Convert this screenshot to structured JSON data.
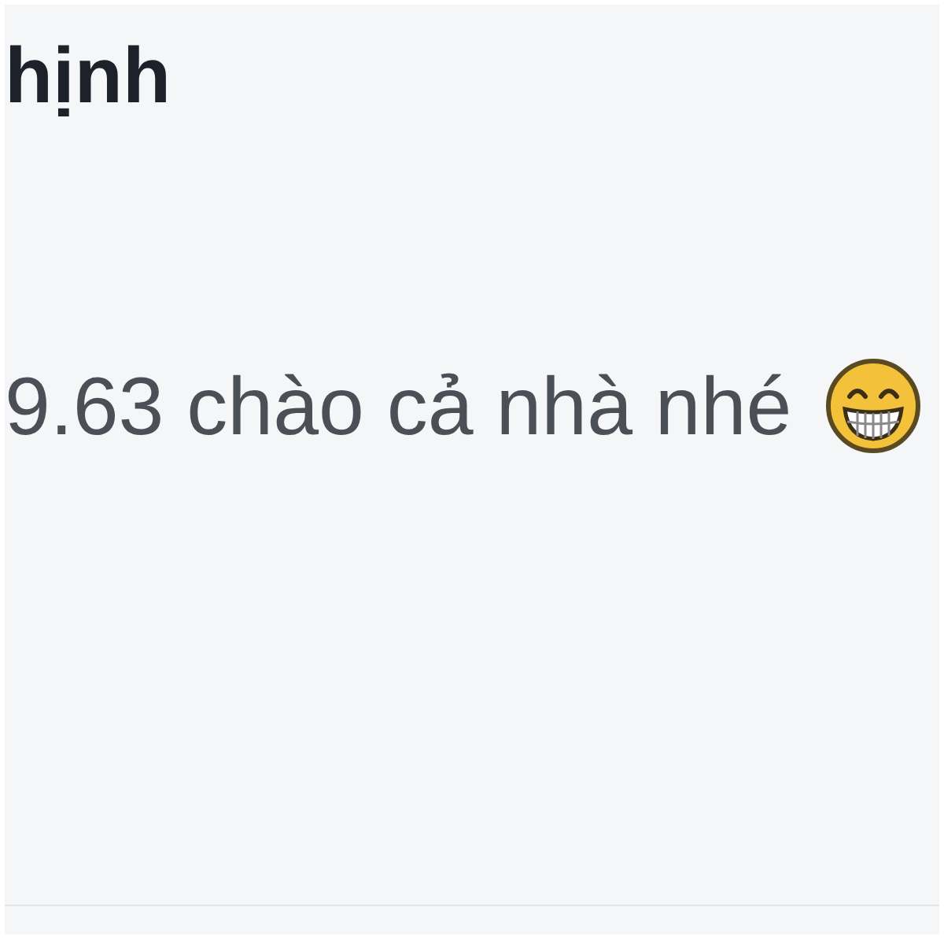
{
  "comment": {
    "author": "hịnh",
    "text": "9.63 chào cả nhà nhé"
  }
}
